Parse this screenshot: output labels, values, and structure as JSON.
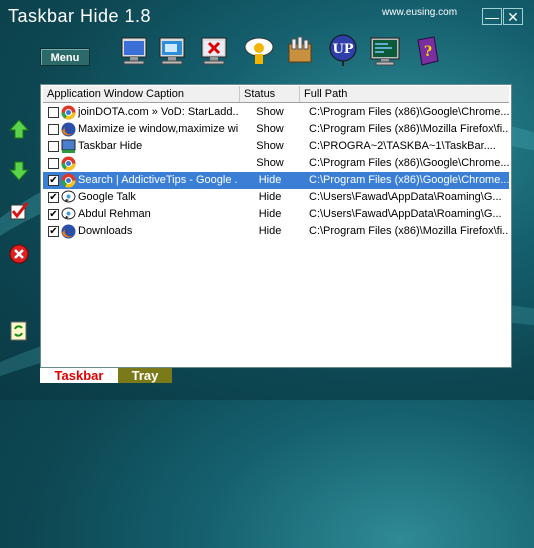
{
  "window": {
    "title": "Taskbar Hide 1.8",
    "website": "www.eusing.com",
    "minimize_label": "—",
    "close_label": "✕"
  },
  "menu": {
    "label": "Menu"
  },
  "toolbar_icons": [
    "window-icon",
    "desktop-icon",
    "close-window-icon",
    "messenger-icon",
    "cleanup-icon",
    "update-icon",
    "monitor-icon",
    "help-book-icon"
  ],
  "table": {
    "headers": {
      "caption": "Application Window Caption",
      "status": "Status",
      "path": "Full Path"
    },
    "rows": [
      {
        "checked": false,
        "icon": "chrome-icon",
        "caption": "joinDOTA.com » VoD: StarLadd...",
        "status": "Show",
        "path": "C:\\Program Files (x86)\\Google\\Chrome...",
        "selected": false
      },
      {
        "checked": false,
        "icon": "firefox-icon",
        "caption": "Maximize ie window,maximize wi...",
        "status": "Show",
        "path": "C:\\Program Files (x86)\\Mozilla Firefox\\fi...",
        "selected": false
      },
      {
        "checked": false,
        "icon": "taskbar-hide-icon",
        "caption": "Taskbar Hide",
        "status": "Show",
        "path": "C:\\PROGRA~2\\TASKBA~1\\TaskBar....",
        "selected": false
      },
      {
        "checked": false,
        "icon": "chrome-icon",
        "caption": "",
        "status": "Show",
        "path": "C:\\Program Files (x86)\\Google\\Chrome...",
        "selected": false
      },
      {
        "checked": true,
        "icon": "chrome-icon",
        "caption": "Search | AddictiveTips - Google ...",
        "status": "Hide",
        "path": "C:\\Program Files (x86)\\Google\\Chrome...",
        "selected": true
      },
      {
        "checked": true,
        "icon": "google-talk-icon",
        "caption": "Google Talk",
        "status": "Hide",
        "path": "C:\\Users\\Fawad\\AppData\\Roaming\\G...",
        "selected": false
      },
      {
        "checked": true,
        "icon": "google-talk-icon",
        "caption": "Abdul Rehman",
        "status": "Hide",
        "path": "C:\\Users\\Fawad\\AppData\\Roaming\\G...",
        "selected": false
      },
      {
        "checked": true,
        "icon": "firefox-icon",
        "caption": "Downloads",
        "status": "Hide",
        "path": "C:\\Program Files (x86)\\Mozilla Firefox\\fi...",
        "selected": false
      }
    ]
  },
  "side_icons": [
    "move-up-arrow-icon",
    "move-down-arrow-icon",
    "check-mark-icon",
    "delete-icon",
    "refresh-icon"
  ],
  "tabs": {
    "taskbar": "Taskbar",
    "tray": "Tray"
  },
  "colors": {
    "selection": "#3a7fd5",
    "taskbar_tab_text": "#e00000",
    "tray_tab_bg": "#7a7a18"
  }
}
